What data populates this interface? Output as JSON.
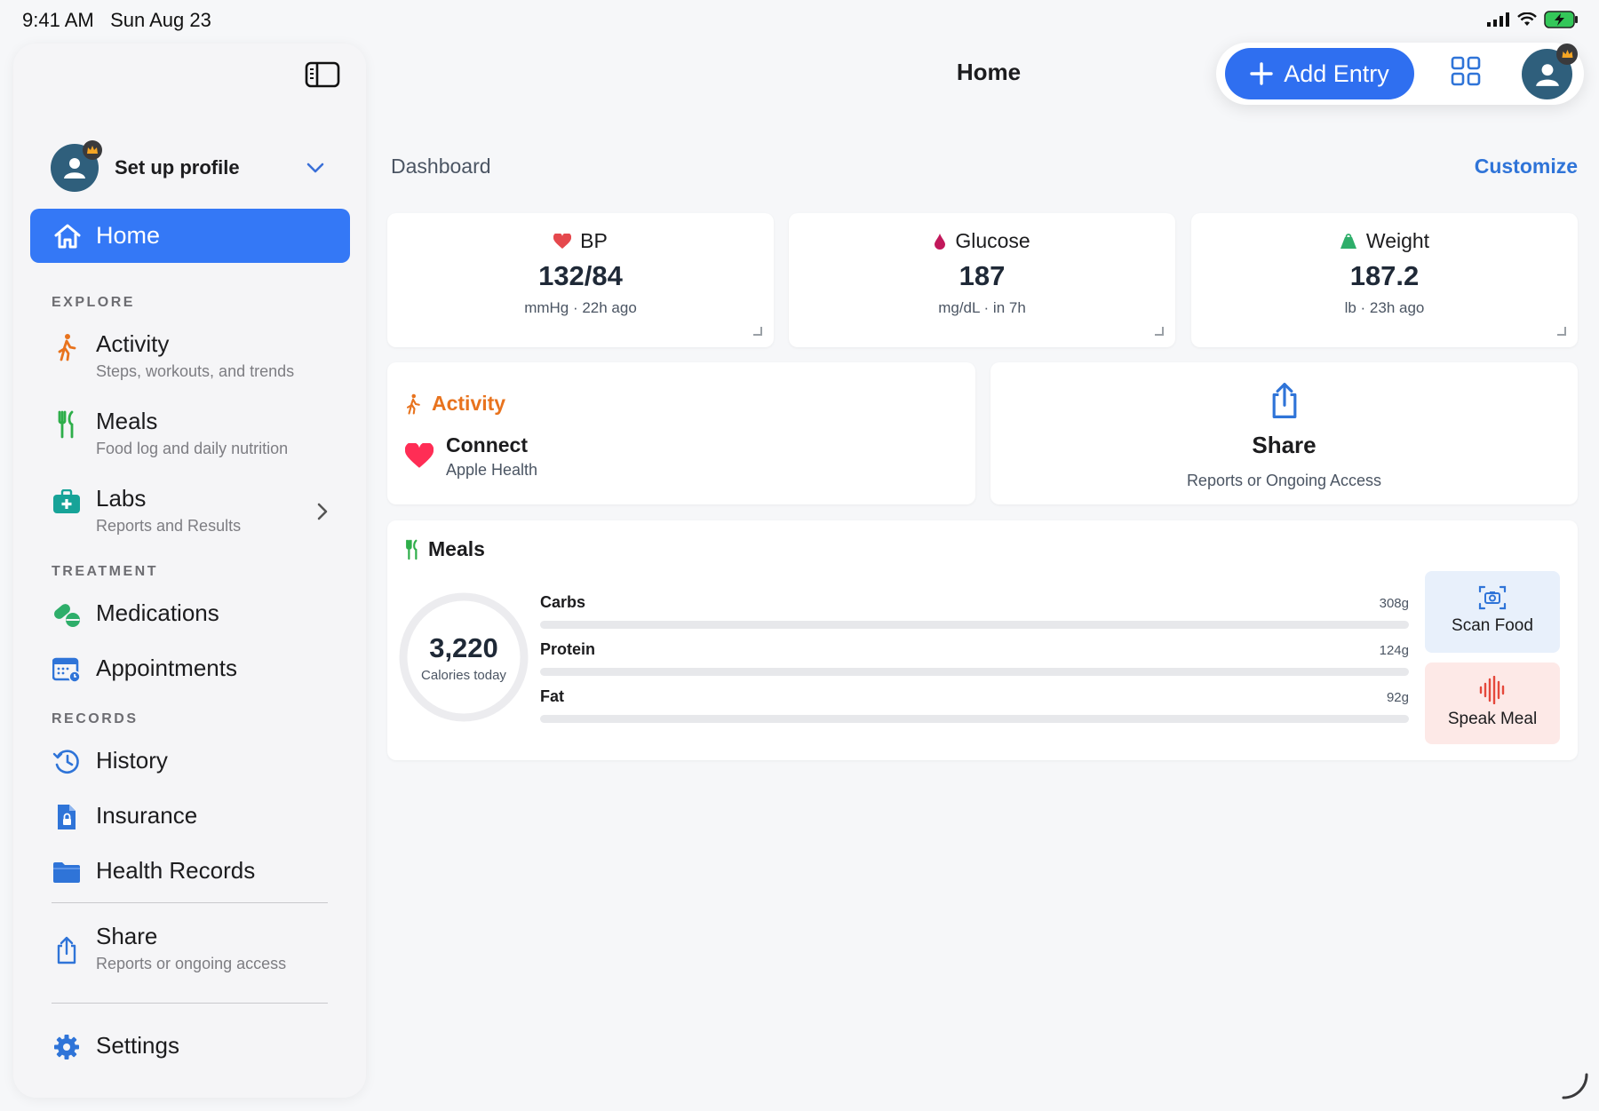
{
  "status_bar": {
    "time": "9:41 AM",
    "date": "Sun Aug 23"
  },
  "sidebar": {
    "profile_label": "Set up profile",
    "home_label": "Home",
    "sections": {
      "explore": "EXPLORE",
      "treatment": "TREATMENT",
      "records": "RECORDS"
    },
    "items": {
      "activity": {
        "title": "Activity",
        "subtitle": "Steps, workouts, and trends"
      },
      "meals": {
        "title": "Meals",
        "subtitle": "Food log and daily nutrition"
      },
      "labs": {
        "title": "Labs",
        "subtitle": "Reports and Results"
      },
      "medications": {
        "title": "Medications"
      },
      "appointments": {
        "title": "Appointments"
      },
      "history": {
        "title": "History"
      },
      "insurance": {
        "title": "Insurance"
      },
      "health_records": {
        "title": "Health Records"
      },
      "share": {
        "title": "Share",
        "subtitle": "Reports or ongoing access"
      },
      "settings": {
        "title": "Settings"
      }
    }
  },
  "header": {
    "title": "Home",
    "add_entry_label": "Add Entry"
  },
  "dashboard": {
    "label": "Dashboard",
    "customize_label": "Customize",
    "metrics": [
      {
        "title": "BP",
        "value": "132/84",
        "sub": "mmHg · 22h ago",
        "icon": "heart-icon",
        "color": "#e5484d"
      },
      {
        "title": "Glucose",
        "value": "187",
        "sub": "mg/dL · in 7h",
        "icon": "drop-icon",
        "color": "#c2185b"
      },
      {
        "title": "Weight",
        "value": "187.2",
        "sub": "lb · 23h ago",
        "icon": "scale-icon",
        "color": "#2eae6a"
      }
    ],
    "activity_card": {
      "title": "Activity",
      "connect_title": "Connect",
      "connect_subtitle": "Apple Health"
    },
    "share_card": {
      "title": "Share",
      "subtitle": "Reports or Ongoing Access"
    },
    "meals_card": {
      "title": "Meals",
      "calories": "3,220",
      "calories_label": "Calories today",
      "macros": [
        {
          "name": "Carbs",
          "amount": "308g"
        },
        {
          "name": "Protein",
          "amount": "124g"
        },
        {
          "name": "Fat",
          "amount": "92g"
        }
      ],
      "scan_label": "Scan Food",
      "speak_label": "Speak Meal"
    }
  },
  "colors": {
    "accent": "#3478f6",
    "activity": "#e8731e",
    "meals_green": "#2eae4a"
  }
}
